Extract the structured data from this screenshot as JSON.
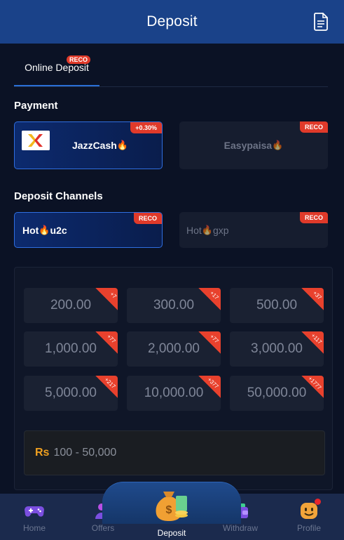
{
  "header": {
    "title": "Deposit",
    "icon": "document-icon"
  },
  "tabs": [
    {
      "label": "Online Deposit",
      "badge": "RECO",
      "active": true
    }
  ],
  "payment": {
    "title": "Payment",
    "options": [
      {
        "label": "JazzCash",
        "badge": "+0.30%",
        "flame": "🔥",
        "selected": true
      },
      {
        "label": "Easypaisa",
        "badge": "RECO",
        "flame": "🔥",
        "selected": false
      }
    ]
  },
  "channels": {
    "title": "Deposit Channels",
    "options": [
      {
        "prefix": "Hot",
        "suffix": "u2c",
        "badge": "RECO",
        "flame": "🔥",
        "selected": true
      },
      {
        "prefix": "Hot",
        "suffix": "gxp",
        "badge": "RECO",
        "flame": "🔥",
        "selected": false
      }
    ]
  },
  "amounts": [
    {
      "value": "200.00",
      "bonus": "+7"
    },
    {
      "value": "300.00",
      "bonus": "+17"
    },
    {
      "value": "500.00",
      "bonus": "+37"
    },
    {
      "value": "1,000.00",
      "bonus": "+77"
    },
    {
      "value": "2,000.00",
      "bonus": "+77"
    },
    {
      "value": "3,000.00",
      "bonus": "+117"
    },
    {
      "value": "5,000.00",
      "bonus": "+217"
    },
    {
      "value": "10,000.00",
      "bonus": "+377"
    },
    {
      "value": "50,000.00",
      "bonus": "+1777"
    }
  ],
  "range": {
    "currency": "Rs",
    "text": "100 - 50,000"
  },
  "nav": [
    {
      "label": "Home",
      "icon": "gamepad-icon"
    },
    {
      "label": "Offers",
      "icon": "offers-icon"
    },
    {
      "label": "Deposit",
      "icon": "money-bag-icon"
    },
    {
      "label": "Withdraw",
      "icon": "wallet-icon"
    },
    {
      "label": "Profile",
      "icon": "smiley-icon"
    }
  ],
  "colors": {
    "header": "#1a4289",
    "accent": "#2f6ee0",
    "badge": "#e03a2a",
    "currency": "#f0a020"
  }
}
